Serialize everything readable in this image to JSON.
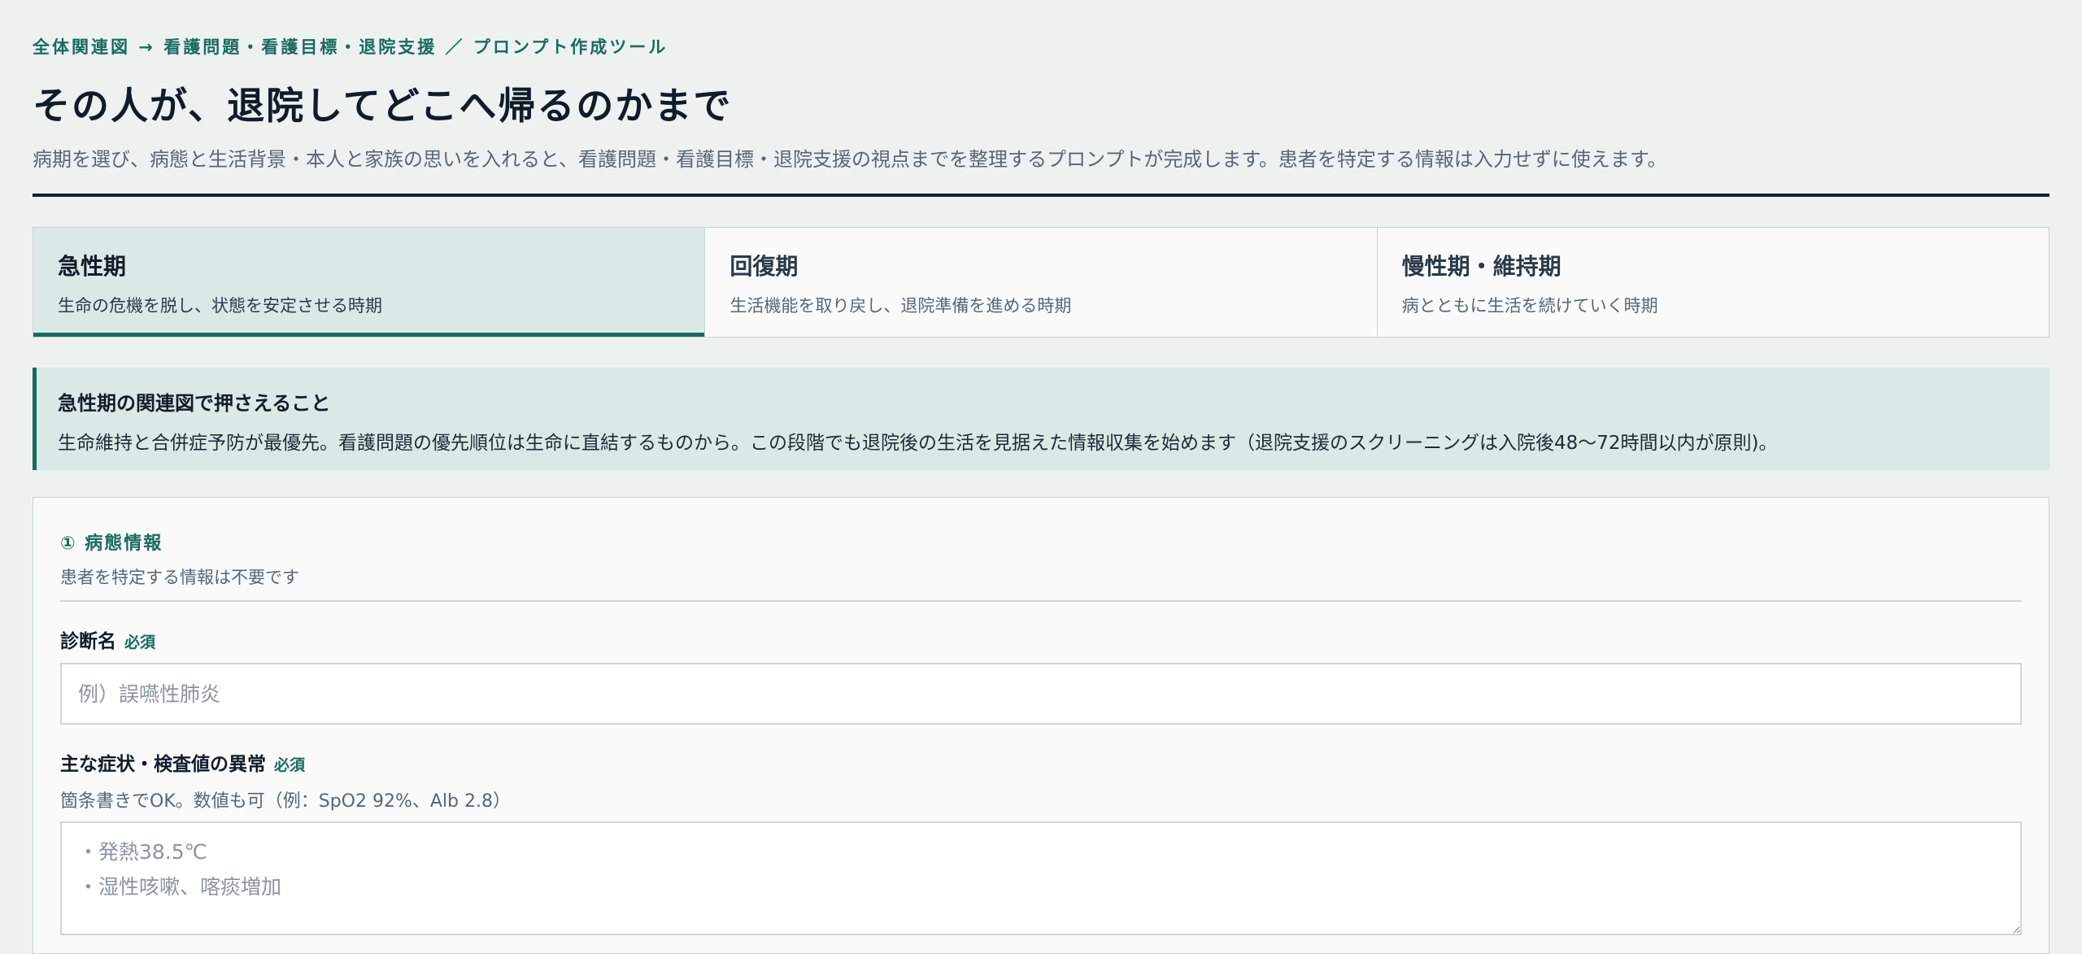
{
  "header": {
    "breadcrumb": "全体関連図 → 看護問題・看護目標・退院支援 ／ プロンプト作成ツール",
    "title": "その人が、退院してどこへ帰るのかまで",
    "description": "病期を選び、病態と生活背景・本人と家族の思いを入れると、看護問題・看護目標・退院支援の視点までを整理するプロンプトが完成します。患者を特定する情報は入力せずに使えます。"
  },
  "tabs": [
    {
      "title": "急性期",
      "subtitle": "生命の危機を脱し、状態を安定させる時期",
      "active": true
    },
    {
      "title": "回復期",
      "subtitle": "生活機能を取り戻し、退院準備を進める時期",
      "active": false
    },
    {
      "title": "慢性期・維持期",
      "subtitle": "病とともに生活を続けていく時期",
      "active": false
    }
  ],
  "callout": {
    "title": "急性期の関連図で押さえること",
    "body": "生命維持と合併症予防が最優先。看護問題の優先順位は生命に直結するものから。この段階でも退院後の生活を見据えた情報収集を始めます（退院支援のスクリーニングは入院後48〜72時間以内が原則)。"
  },
  "section": {
    "title": "① 病態情報",
    "subtitle": "患者を特定する情報は不要です"
  },
  "fields": {
    "diagnosis": {
      "label": "診断名",
      "required": "必須",
      "placeholder": "例）誤嚥性肺炎",
      "value": ""
    },
    "symptoms": {
      "label": "主な症状・検査値の異常",
      "required": "必須",
      "help": "箇条書きでOK。数値も可（例：SpO2 92%、Alb 2.8）",
      "placeholder": "・発熱38.5℃\n・湿性咳嗽、喀痰増加",
      "value": ""
    }
  },
  "colors": {
    "accent": "#1a6b5c",
    "background": "#edf2f0",
    "active_tab": "#dbe9e6",
    "heading": "#121c2a"
  }
}
